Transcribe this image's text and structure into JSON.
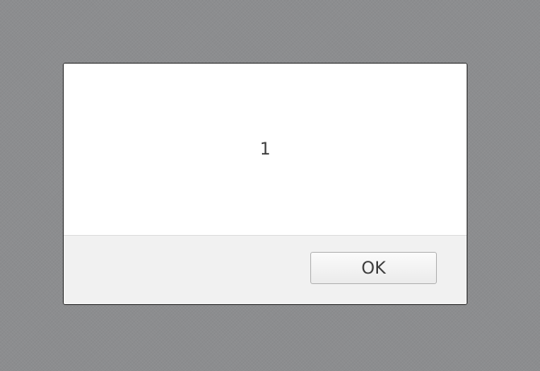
{
  "dialog": {
    "message": "1",
    "ok_label": "OK"
  }
}
